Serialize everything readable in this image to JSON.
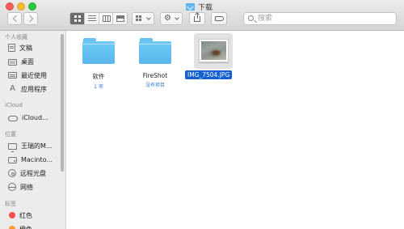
{
  "window": {
    "title": "下载"
  },
  "toolbar": {
    "search_placeholder": "搜索",
    "gear_glyph": "⚙"
  },
  "sidebar": {
    "sections": [
      {
        "header": "个人收藏",
        "items": [
          {
            "label": "文稿",
            "icon": "document-icon"
          },
          {
            "label": "桌面",
            "icon": "desktop-icon"
          },
          {
            "label": "最近使用",
            "icon": "recents-icon"
          },
          {
            "label": "应用程序",
            "icon": "applications-icon"
          }
        ]
      },
      {
        "header": "iCloud",
        "items": [
          {
            "label": "iCloud...",
            "icon": "icloud-icon"
          }
        ]
      },
      {
        "header": "位置",
        "items": [
          {
            "label": "王瑞的M...",
            "icon": "computer-icon"
          },
          {
            "label": "Macinto...",
            "icon": "harddrive-icon"
          },
          {
            "label": "远程光盘",
            "icon": "disc-icon"
          },
          {
            "label": "网络",
            "icon": "network-icon"
          }
        ]
      },
      {
        "header": "标签",
        "items": [
          {
            "label": "红色",
            "icon": "red-tag-icon",
            "color": "#fc4e4e"
          },
          {
            "label": "橙色",
            "icon": "orange-tag-icon",
            "color": "#fd9a2b"
          }
        ]
      }
    ]
  },
  "files": [
    {
      "name": "软件",
      "meta": "1 项",
      "kind": "folder"
    },
    {
      "name": "FireShot",
      "meta": "没有项目",
      "kind": "folder"
    },
    {
      "name": "IMG_7504.JPG",
      "kind": "image",
      "selected": true
    }
  ],
  "colors": {
    "selection": "#1560d0",
    "folder": "#5ab7ec",
    "meta_text": "#3b7fd6"
  }
}
